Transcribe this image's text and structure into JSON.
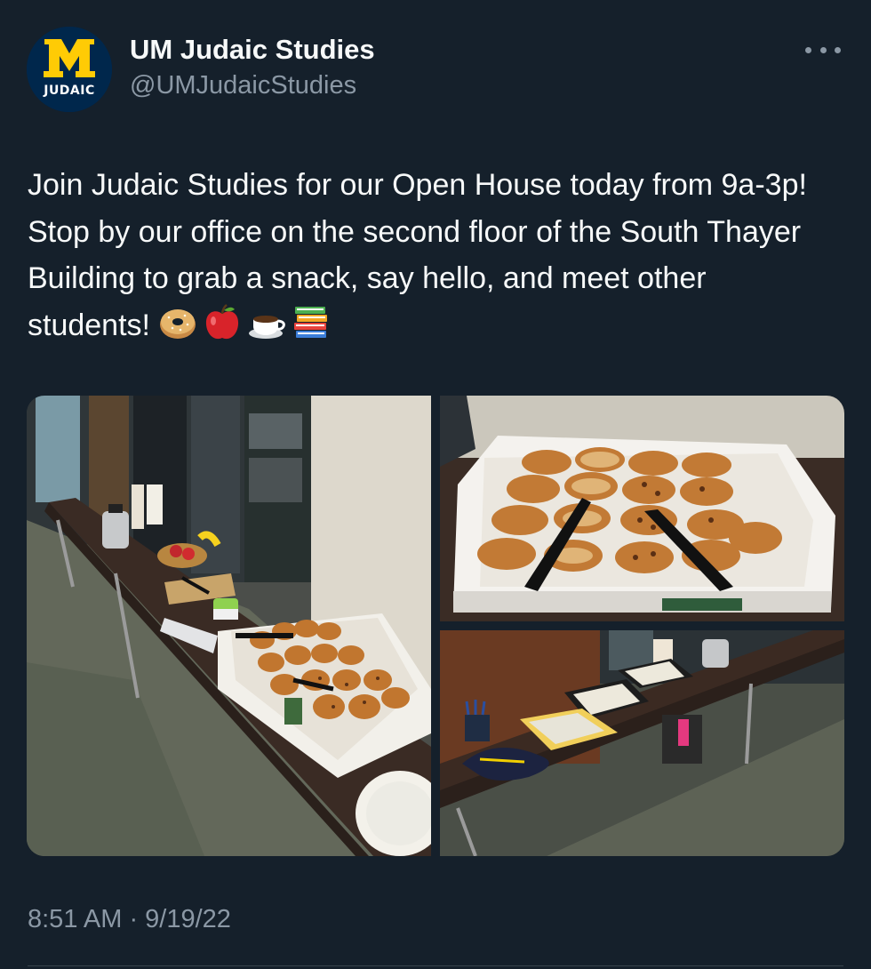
{
  "account": {
    "display_name": "UM Judaic Studies",
    "handle": "@UMJudaicStudies",
    "avatar_text": "JUDAIC",
    "avatar_logo": "M"
  },
  "menu": {
    "more_icon": "more-horizontal-icon"
  },
  "tweet": {
    "text": "Join Judaic Studies for our Open House today from 9a-3p! Stop by our office on the second floor of the South Thayer Building to grab a snack, say hello, and meet other students! ",
    "emojis": [
      "bagel-emoji",
      "red-apple-emoji",
      "hot-beverage-emoji",
      "books-emoji"
    ]
  },
  "media": {
    "photos": [
      "table-with-snacks-and-bagels-photo",
      "bagel-tray-closeup-photo",
      "table-with-brochures-and-lanyards-photo"
    ]
  },
  "meta": {
    "timestamp": "8:51 AM · 9/19/22"
  },
  "colors": {
    "background": "#15202b",
    "primary_text": "#f7f9f9",
    "secondary_text": "#8b98a5",
    "um_blue": "#00274c",
    "um_maize": "#ffcb05"
  }
}
